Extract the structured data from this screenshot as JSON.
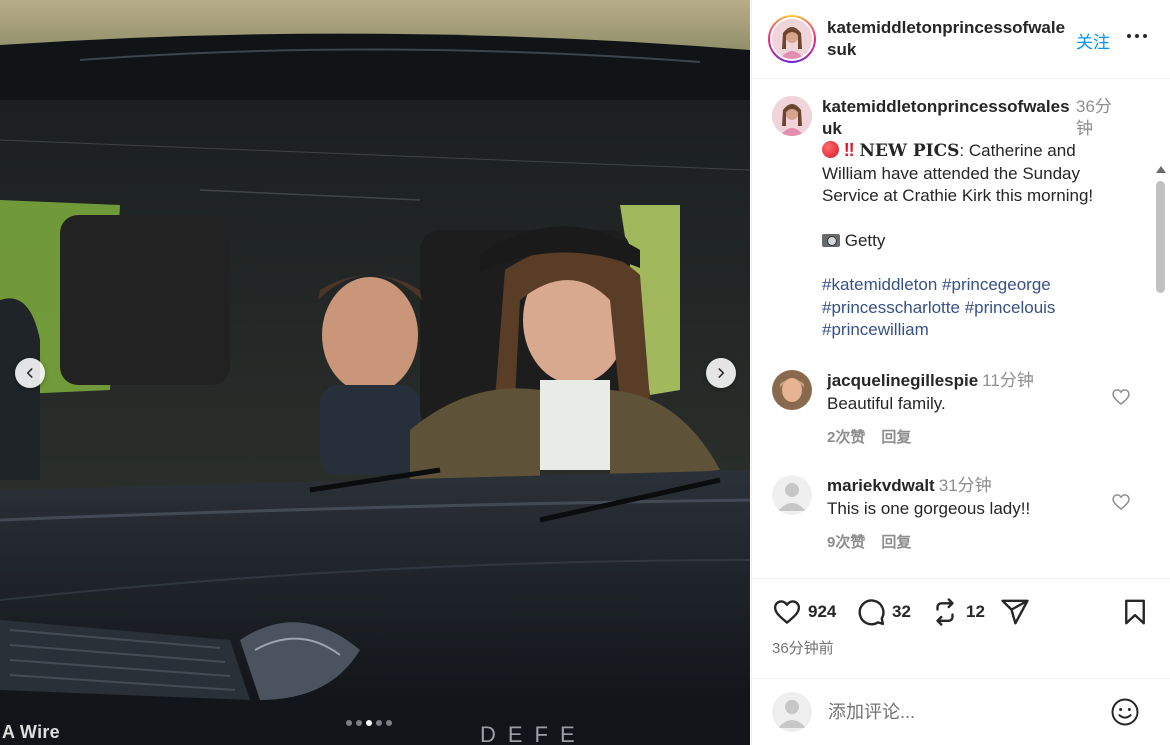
{
  "media": {
    "credit": "A Wire",
    "carousel": {
      "total": 5,
      "current": 3
    }
  },
  "header": {
    "username": "katemiddletonprincessofwalesuk",
    "follow_label": "关注"
  },
  "caption": {
    "username": "katemiddletonprincessofwalesuk",
    "time": "36分钟",
    "headline_bold": "NEW PICS",
    "headline_rest": ": Catherine and William have attended the Sunday Service at Crathie Kirk this morning!",
    "credit_text": "Getty",
    "hashtags": [
      "#katemiddleton",
      "#princegeorge",
      "#princesscharlotte",
      "#princelouis",
      "#princewilliam"
    ]
  },
  "comments": [
    {
      "username": "jacquelinegillespie",
      "time": "11分钟",
      "text": "Beautiful family.",
      "likes": "2次赞",
      "reply": "回复"
    },
    {
      "username": "mariekvdwalt",
      "time": "31分钟",
      "text": "This is one gorgeous lady!!",
      "likes": "9次赞",
      "reply": "回复"
    }
  ],
  "actions": {
    "like_count": "924",
    "comment_count": "32",
    "repost_count": "12",
    "posted_time": "36分钟前"
  },
  "add_comment": {
    "placeholder": "添加评论..."
  },
  "colors": {
    "link": "#0095f6",
    "hashtag": "#385185",
    "muted": "#8e8e8e",
    "text": "#262626"
  },
  "icons": {
    "prev": "chevron-left-icon",
    "next": "chevron-right-icon",
    "more": "more-horizontal-icon",
    "like": "heart-icon",
    "comment": "comment-bubble-icon",
    "repost": "repost-icon",
    "share": "paper-plane-icon",
    "save": "bookmark-icon",
    "emoji": "smiley-icon"
  }
}
